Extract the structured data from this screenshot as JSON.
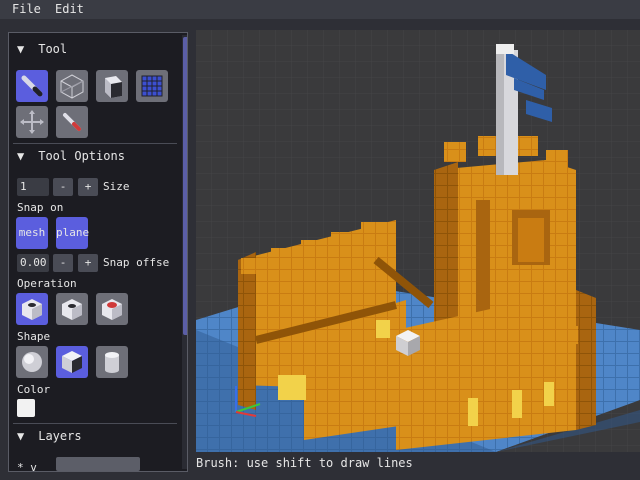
{
  "menubar": {
    "file": "File",
    "edit": "Edit"
  },
  "panel": {
    "tool_header": "Tool",
    "tool_options_header": "Tool Options",
    "size_value": "1",
    "minus": "-",
    "plus": "+",
    "size_label": "Size",
    "snap_on_label": "Snap on",
    "snap_mesh": "mesh",
    "snap_plane": "plane",
    "snap_offset_value": "0.00",
    "snap_offset_label": "Snap offse",
    "operation_label": "Operation",
    "shape_label": "Shape",
    "color_label": "Color",
    "layers_header": "Layers",
    "layer_row_marks": "* v"
  },
  "colors": {
    "accent": "#5b5ede",
    "tower_orange": "#d9901a",
    "base_blue": "#4f86c8",
    "flag_blue": "#2f5fa8"
  },
  "status": "Brush: use shift to draw lines"
}
